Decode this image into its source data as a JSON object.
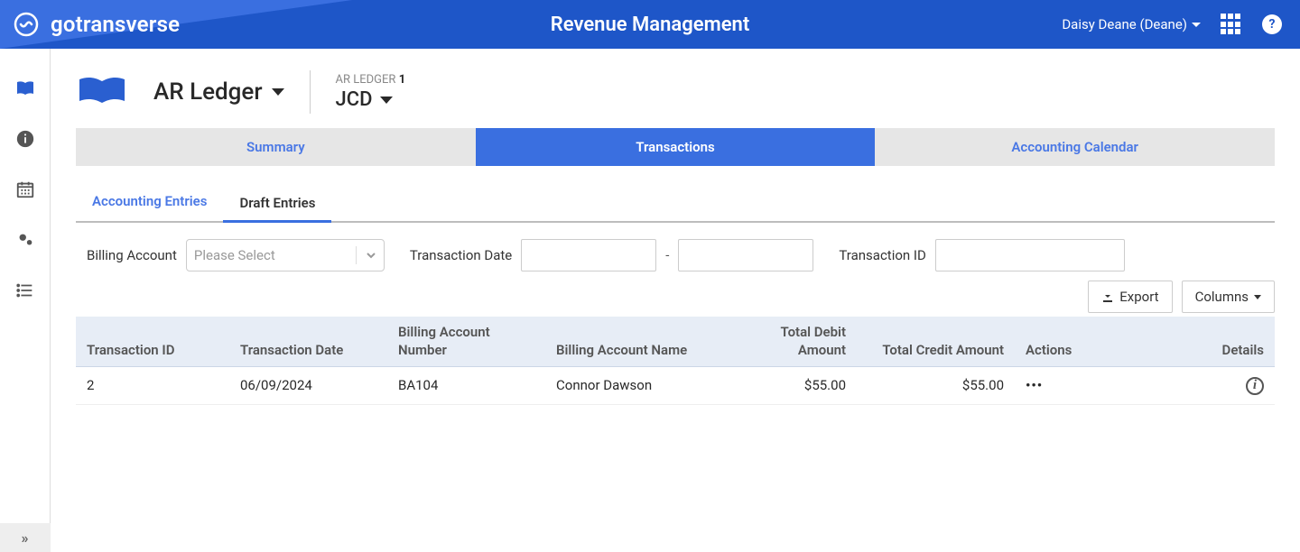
{
  "app": {
    "brand": "gotransverse",
    "title": "Revenue Management",
    "user": "Daisy Deane (Deane)"
  },
  "header": {
    "ledger_label": "AR Ledger",
    "sub_label_prefix": "AR LEDGER",
    "sub_label_num": "1",
    "sub_value": "JCD"
  },
  "tabs": {
    "main": [
      "Summary",
      "Transactions",
      "Accounting Calendar"
    ],
    "sub": [
      "Accounting Entries",
      "Draft Entries"
    ]
  },
  "filters": {
    "billing_account_label": "Billing Account",
    "billing_account_placeholder": "Please Select",
    "txn_date_label": "Transaction Date",
    "txn_id_label": "Transaction ID"
  },
  "toolbar": {
    "export_label": "Export",
    "columns_label": "Columns"
  },
  "table": {
    "headers": {
      "txn_id": "Transaction ID",
      "txn_date": "Transaction Date",
      "ba_num": "Billing Account Number",
      "ba_name": "Billing Account Name",
      "debit": "Total Debit Amount",
      "credit": "Total Credit Amount",
      "actions": "Actions",
      "details": "Details"
    },
    "rows": [
      {
        "txn_id": "2",
        "txn_date": "06/09/2024",
        "ba_num": "BA104",
        "ba_name": "Connor Dawson",
        "debit": "$55.00",
        "credit": "$55.00"
      }
    ]
  }
}
